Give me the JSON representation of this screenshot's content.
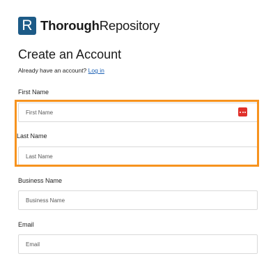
{
  "brand": {
    "logo_letter": "R",
    "name_bold": "Thorough",
    "name_light": "Repository",
    "color": "#1d5b87"
  },
  "page": {
    "title": "Create an Account",
    "login_prompt": "Already have an account?",
    "login_link": "Log in"
  },
  "form": {
    "first_name": {
      "label": "First Name",
      "placeholder": "First Name"
    },
    "last_name": {
      "label": "Last Name",
      "placeholder": "Last Name"
    },
    "business_name": {
      "label": "Business Name",
      "placeholder": "Business Name"
    },
    "email": {
      "label": "Email",
      "placeholder": "Email"
    }
  },
  "icons": {
    "password_manager": "password-manager-icon"
  },
  "colors": {
    "highlight": "#f7931e",
    "link": "#1a5fb4",
    "password_manager": "#e0312b"
  }
}
